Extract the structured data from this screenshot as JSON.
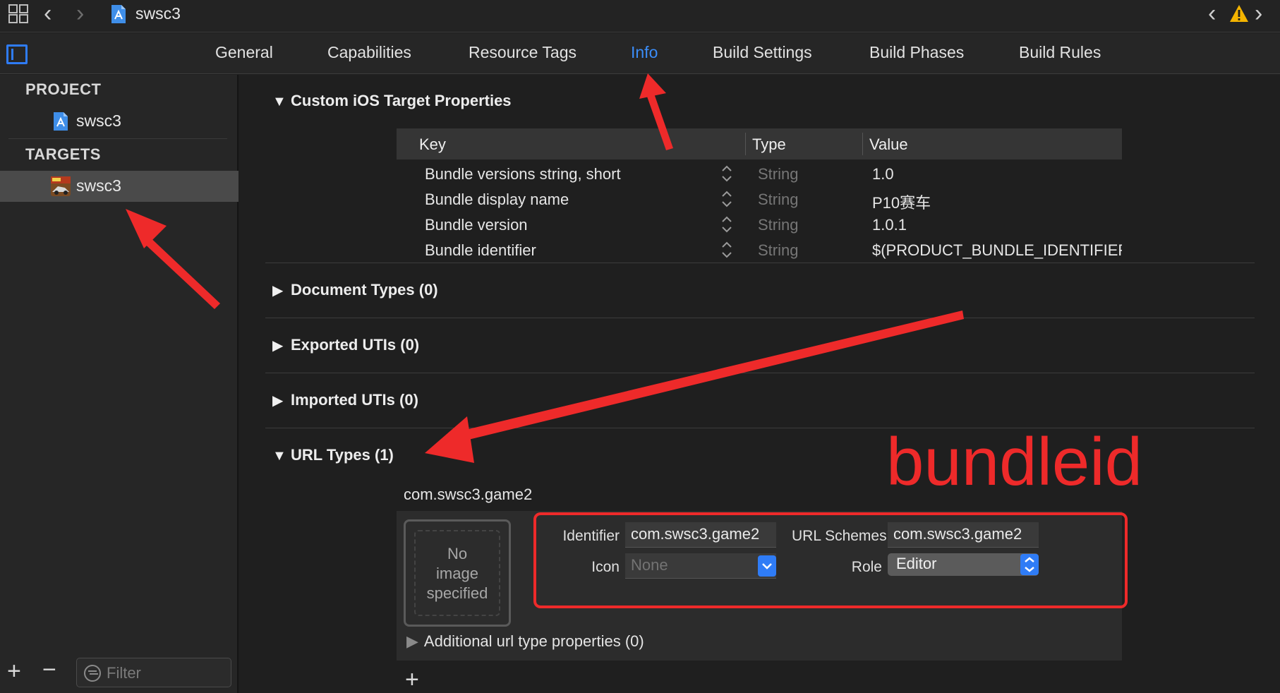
{
  "window": {
    "title": "swsc3"
  },
  "tabs": [
    {
      "label": "General",
      "active": false
    },
    {
      "label": "Capabilities",
      "active": false
    },
    {
      "label": "Resource Tags",
      "active": false
    },
    {
      "label": "Info",
      "active": true
    },
    {
      "label": "Build Settings",
      "active": false
    },
    {
      "label": "Build Phases",
      "active": false
    },
    {
      "label": "Build Rules",
      "active": false
    }
  ],
  "sidebar": {
    "project_heading": "PROJECT",
    "project_item": "swsc3",
    "targets_heading": "TARGETS",
    "target_item": "swsc3",
    "filter_placeholder": "Filter"
  },
  "sections": {
    "custom": "Custom iOS Target Properties",
    "document_types": "Document Types (0)",
    "exported_utis": "Exported UTIs (0)",
    "imported_utis": "Imported UTIs (0)",
    "url_types": "URL Types (1)"
  },
  "properties_table": {
    "headers": {
      "key": "Key",
      "type": "Type",
      "value": "Value"
    },
    "rows": [
      {
        "key": "Bundle versions string, short",
        "type": "String",
        "value": "1.0"
      },
      {
        "key": "Bundle display name",
        "type": "String",
        "value": "P10赛车"
      },
      {
        "key": "Bundle version",
        "type": "String",
        "value": "1.0.1"
      },
      {
        "key": "Bundle identifier",
        "type": "String",
        "value": "$(PRODUCT_BUNDLE_IDENTIFIER"
      }
    ]
  },
  "url_type": {
    "name": "com.swsc3.game2",
    "image_placeholder_line1": "No",
    "image_placeholder_line2": "image",
    "image_placeholder_line3": "specified",
    "identifier_label": "Identifier",
    "identifier_value": "com.swsc3.game2",
    "icon_label": "Icon",
    "icon_value": "None",
    "url_schemes_label": "URL Schemes",
    "url_schemes_value": "com.swsc3.game2",
    "role_label": "Role",
    "role_value": "Editor",
    "additional": "Additional url type properties (0)"
  },
  "annotation": {
    "text": "bundleid",
    "color": "#ee2a2a"
  },
  "colors": {
    "accent": "#2f7cf6",
    "active_tab": "#3b8df8",
    "warning": "#f4b400"
  },
  "icons": [
    "grid-icon",
    "chevron-left-icon",
    "chevron-right-icon",
    "xcode-file-icon",
    "warning-icon",
    "sidebar-toggle-icon",
    "plus-icon",
    "minus-icon",
    "filter-icon",
    "disclosure-triangle-icon",
    "stepper-icon",
    "popup-chevron-icon"
  ]
}
